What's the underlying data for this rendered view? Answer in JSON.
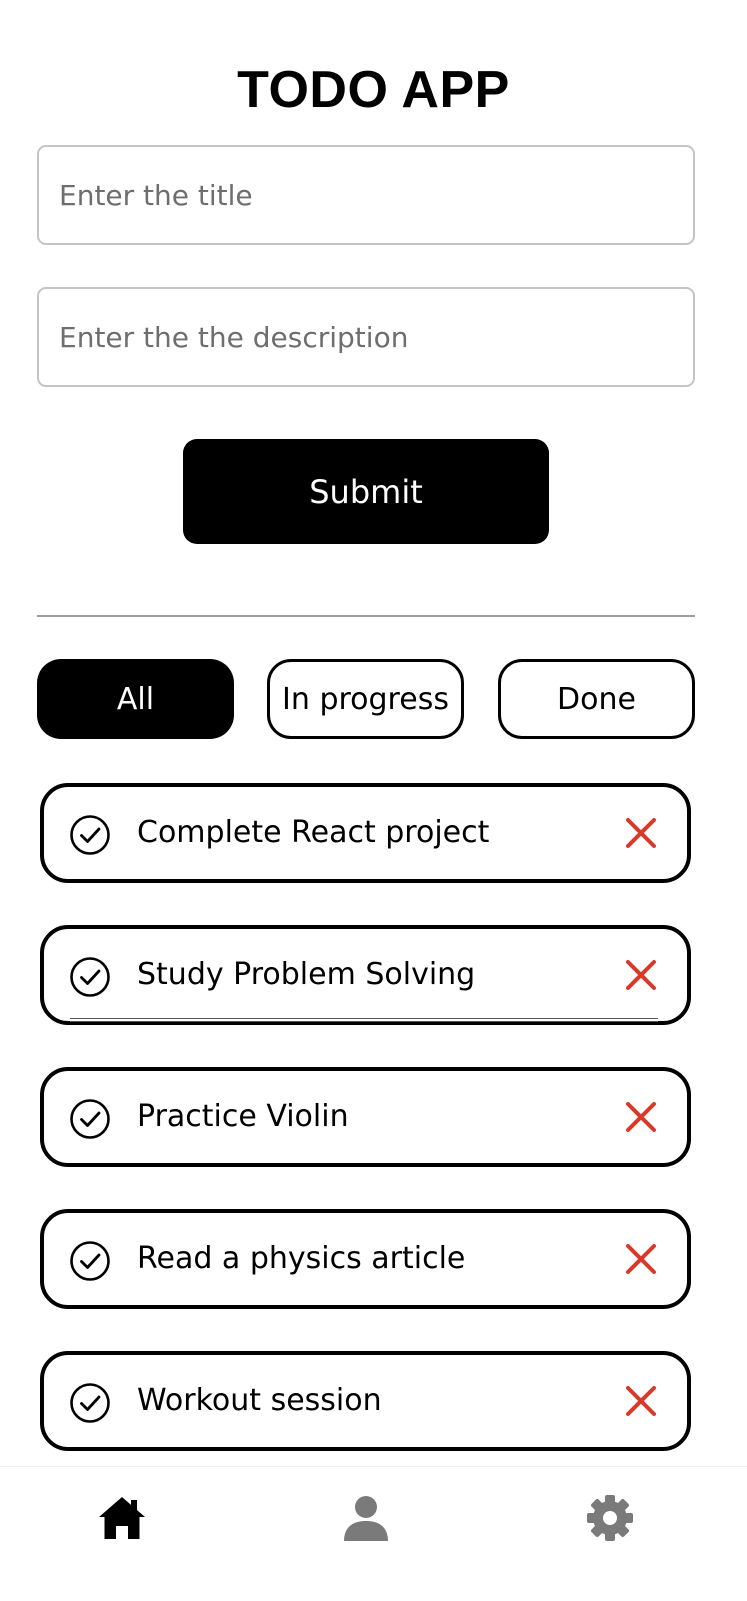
{
  "app": {
    "title": "TODO APP"
  },
  "form": {
    "title_placeholder": "Enter the title",
    "title_value": "",
    "description_placeholder": "Enter the the description",
    "description_value": "",
    "submit_label": "Submit"
  },
  "filters": [
    {
      "label": "All",
      "active": true
    },
    {
      "label": "In progress",
      "active": false
    },
    {
      "label": "Done",
      "active": false
    }
  ],
  "todos": [
    {
      "title": "Complete React project",
      "check_icon": "check-circle-icon",
      "delete_icon": "close-icon"
    },
    {
      "title": "Study Problem Solving",
      "check_icon": "check-circle-icon",
      "delete_icon": "close-icon"
    },
    {
      "title": "Practice Violin",
      "check_icon": "check-circle-icon",
      "delete_icon": "close-icon"
    },
    {
      "title": "Read a physics article",
      "check_icon": "check-circle-icon",
      "delete_icon": "close-icon"
    },
    {
      "title": "Workout session",
      "check_icon": "check-circle-icon",
      "delete_icon": "close-icon"
    }
  ],
  "bottom_nav": {
    "items": [
      {
        "icon": "home-icon",
        "active": true
      },
      {
        "icon": "profile-icon",
        "active": false
      },
      {
        "icon": "settings-icon",
        "active": false
      }
    ]
  },
  "colors": {
    "primary": "#000000",
    "background": "#ffffff",
    "delete": "#d9392b",
    "inactive_nav": "#7a7a7a",
    "input_border": "#c4c4c4"
  }
}
